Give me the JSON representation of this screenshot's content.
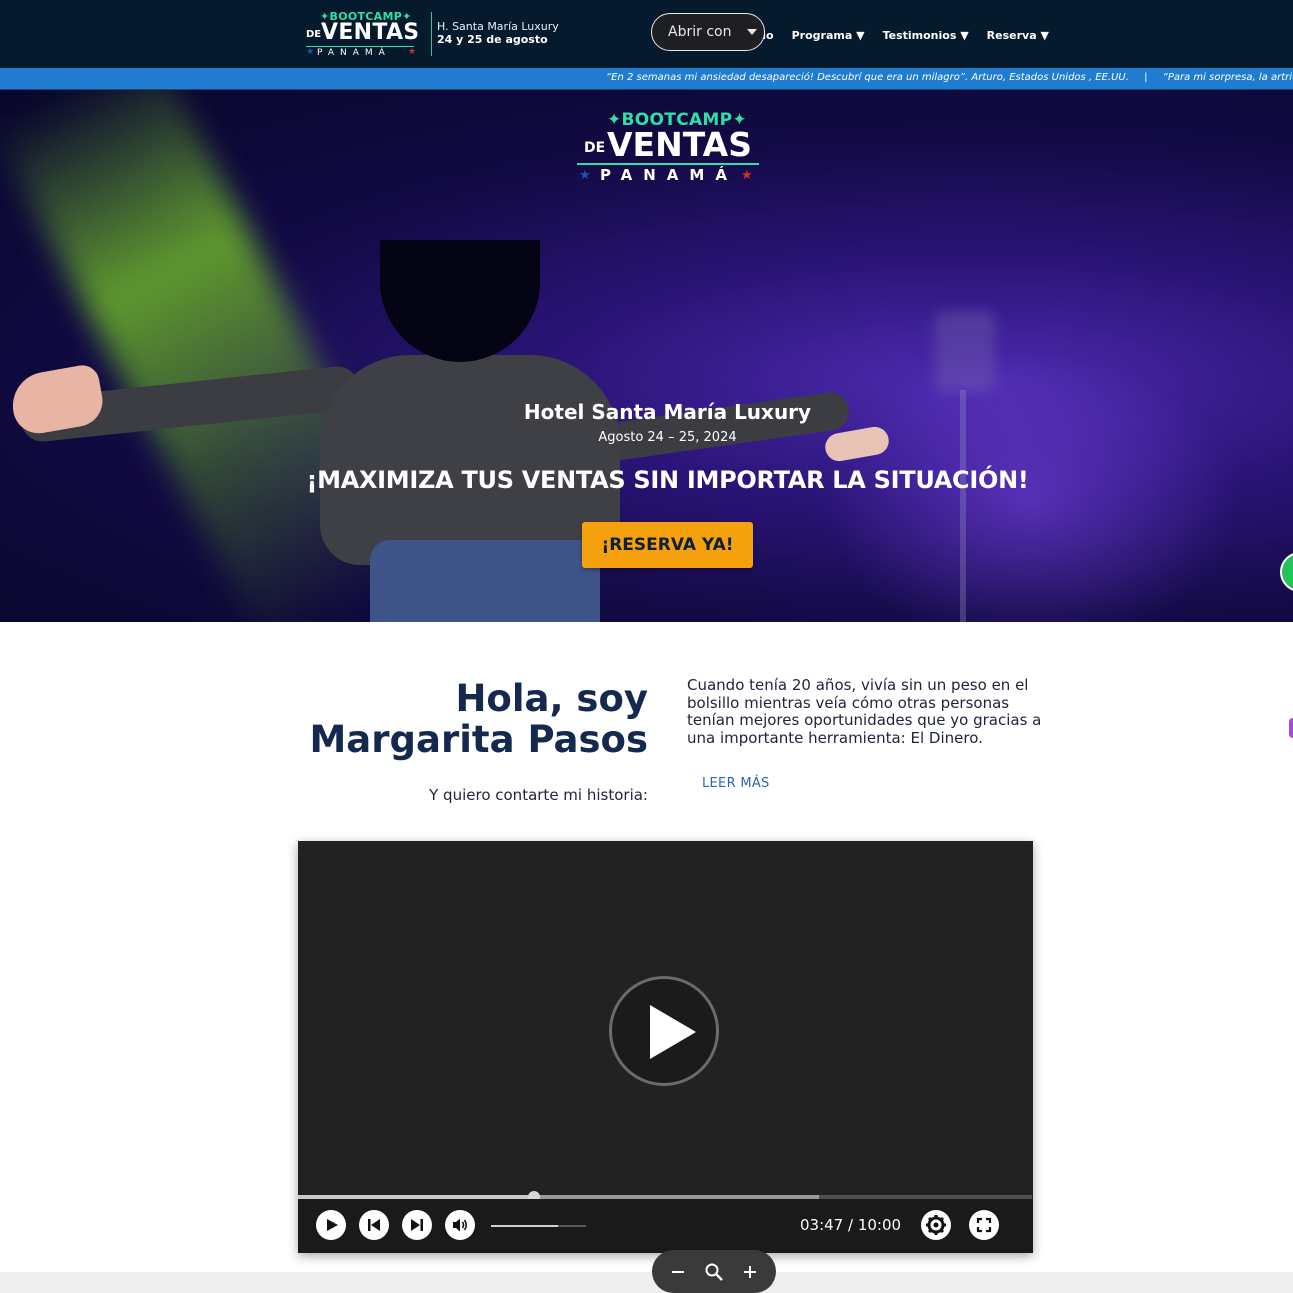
{
  "header": {
    "logo": {
      "line1": "✦BOOTCAMP✦",
      "prefix": "DE",
      "line2": "VENTAS",
      "line3": "PANAMÁ"
    },
    "venue": "H. Santa María Luxury",
    "dates": "24 y 25 de agosto",
    "menu": [
      {
        "label": "icio"
      },
      {
        "label": "Programa ▼"
      },
      {
        "label": "Testimonios ▼"
      },
      {
        "label": "Reserva ▼"
      }
    ],
    "open_with": {
      "label": "Abrir con"
    }
  },
  "ticker": {
    "items": [
      "“En 2 semanas mi ansiedad desapareció! Descubrí que era un milagro”. Arturo, Estados Unidos , EE.UU.",
      "“Para mi sorpresa, la artritis"
    ],
    "separator": "|"
  },
  "hero": {
    "logo": {
      "line1": "✦BOOTCAMP✦",
      "prefix": "DE",
      "line2": "VENTAS",
      "line3": "PANAMÁ"
    },
    "venue": "Hotel Santa María Luxury",
    "dates": "Agosto 24 – 25, 2024",
    "headline": "¡MAXIMIZA TUS VENTAS SIN IMPORTAR LA SITUACIÓN!",
    "cta": "¡RESERVA YA!"
  },
  "intro": {
    "title_line1": "Hola, soy",
    "title_line2": "Margarita Pasos",
    "subtitle": "Y quiero contarte mi historia:",
    "body": "Cuando tenía 20 años, vivía sin un peso en el bolsillo mientras veía cómo otras personas tenían mejores oportunidades que yo gracias a una importante herramienta: El Dinero.",
    "read_more": "LEER MÁS"
  },
  "video": {
    "time": "03:47 / 10:00",
    "progress_fraction": 0.321,
    "buffered_fraction": 0.71,
    "volume_fraction": 0.7
  },
  "colors": {
    "nav_bg": "#061a2e",
    "ticker_bg": "#1f7ccf",
    "cta_bg": "#f5a10d",
    "title_color": "#15294f",
    "accent_green": "#2ee0a4"
  }
}
